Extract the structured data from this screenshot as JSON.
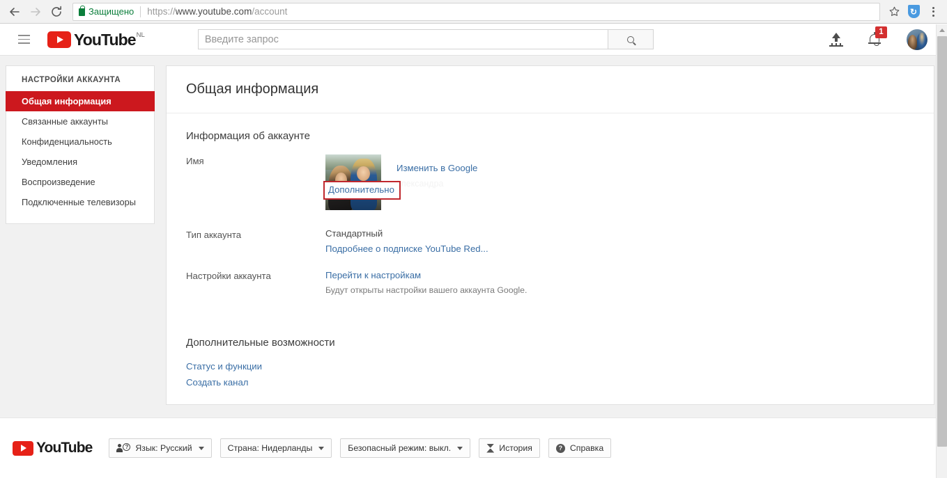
{
  "browser": {
    "back_icon": "back-arrow-icon",
    "forward_icon": "forward-arrow-icon",
    "reload_icon": "reload-icon",
    "secure_label": "Защищено",
    "url_scheme": "https://",
    "url_origin": "www.youtube.com",
    "url_path": "/account",
    "star_icon": "star-icon",
    "extension_icon": "shield-extension-icon",
    "menu_icon": "chrome-menu-icon"
  },
  "header": {
    "menu_icon": "hamburger-menu-icon",
    "logo_text": "YouTube",
    "logo_country": "NL",
    "search_placeholder": "Введите запрос",
    "search_value": "",
    "search_icon": "search-icon",
    "upload_icon": "upload-icon",
    "notifications_icon": "bell-icon",
    "notifications_count": "1",
    "avatar_name": "user-avatar"
  },
  "sidebar": {
    "heading": "НАСТРОЙКИ АККАУНТА",
    "items": [
      {
        "label": "Общая информация",
        "active": true
      },
      {
        "label": "Связанные аккаунты",
        "active": false
      },
      {
        "label": "Конфиденциальность",
        "active": false
      },
      {
        "label": "Уведомления",
        "active": false
      },
      {
        "label": "Воспроизведение",
        "active": false
      },
      {
        "label": "Подключенные телевизоры",
        "active": false
      }
    ]
  },
  "main": {
    "page_title": "Общая информация",
    "account_info_title": "Информация об аккаунте",
    "rows": {
      "name": {
        "label": "Имя",
        "change_link": "Изменить в Google",
        "hidden_name": "Александра",
        "more_link": "Дополнительно",
        "photo_name": "profile-photo"
      },
      "account_type": {
        "label": "Тип аккаунта",
        "value": "Стандартный",
        "link": "Подробнее о подписке YouTube Red..."
      },
      "account_settings": {
        "label": "Настройки аккаунта",
        "link": "Перейти к настройкам",
        "note": "Будут открыты настройки вашего аккаунта Google."
      }
    },
    "extra_title": "Дополнительные возможности",
    "extra_links": [
      "Статус и функции",
      "Создать канал"
    ]
  },
  "footer": {
    "logo_text": "YouTube",
    "buttons": [
      {
        "label": "Язык: Русский",
        "icon": "language-icon",
        "caret": true
      },
      {
        "label": "Страна: Нидерланды",
        "icon": "",
        "caret": true
      },
      {
        "label": "Безопасный режим: выкл.",
        "icon": "",
        "caret": true
      },
      {
        "label": "История",
        "icon": "hourglass-icon",
        "caret": false
      },
      {
        "label": "Справка",
        "icon": "help-icon",
        "caret": false
      }
    ]
  },
  "colors": {
    "youtube_red": "#e62117",
    "sidebar_active": "#cc181e",
    "link_blue": "#3a6ea5",
    "highlight_red": "#c0272d",
    "secure_green": "#0b7e3b",
    "badge_red": "#d32f2f"
  }
}
